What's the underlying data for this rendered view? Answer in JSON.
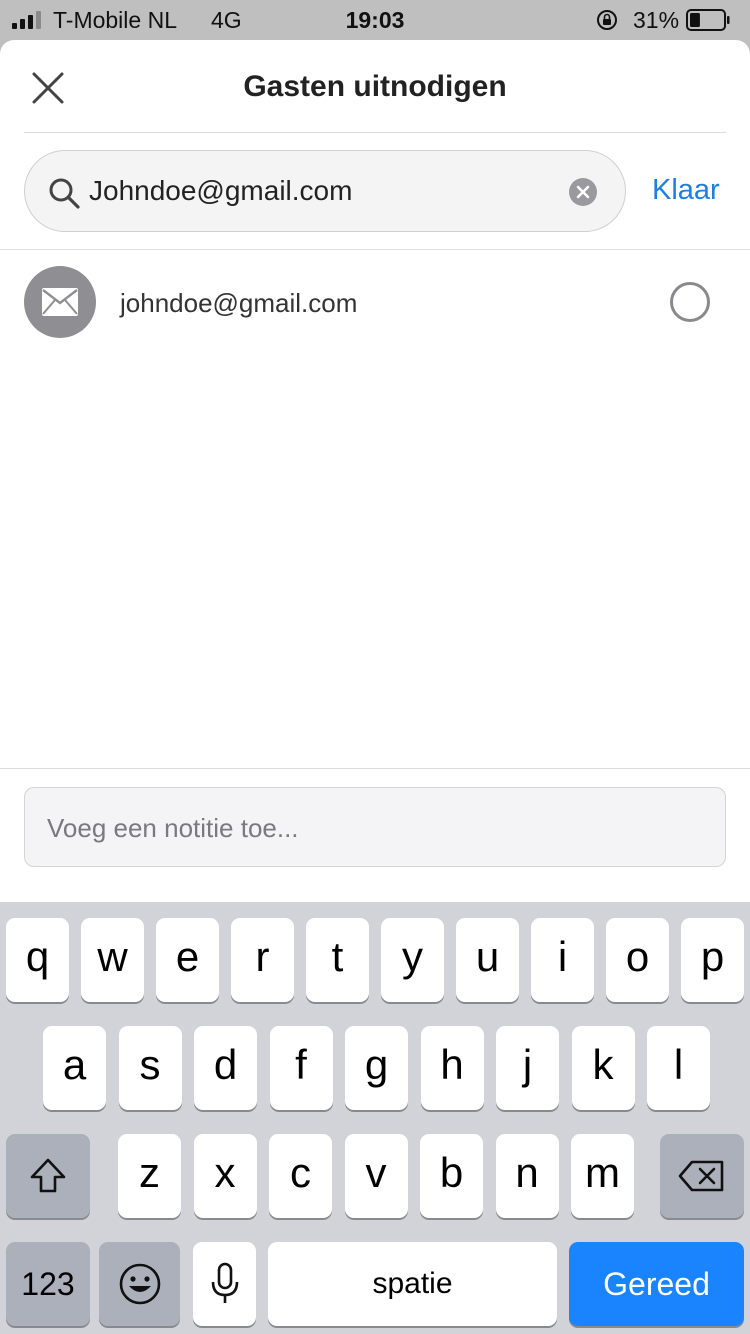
{
  "status_bar": {
    "carrier": "T-Mobile NL",
    "network": "4G",
    "time": "19:03",
    "battery_percent": "31%",
    "battery_level": 0.31,
    "signal_bars": 3
  },
  "header": {
    "title": "Gasten uitnodigen",
    "close_icon": "close-icon"
  },
  "search": {
    "value": "Johndoe@gmail.com",
    "icon": "search-icon",
    "clear_icon": "clear-icon",
    "done_label": "Klaar"
  },
  "results": [
    {
      "email": "johndoe@gmail.com",
      "icon": "mail-icon",
      "selected": false
    }
  ],
  "note": {
    "placeholder": "Voeg een notitie toe..."
  },
  "keyboard": {
    "row1": [
      "q",
      "w",
      "e",
      "r",
      "t",
      "y",
      "u",
      "i",
      "o",
      "p"
    ],
    "row2": [
      "a",
      "s",
      "d",
      "f",
      "g",
      "h",
      "j",
      "k",
      "l"
    ],
    "row3": [
      "z",
      "x",
      "c",
      "v",
      "b",
      "n",
      "m"
    ],
    "numbers_label": "123",
    "space_label": "spatie",
    "return_label": "Gereed"
  },
  "colors": {
    "accent": "#1f7fe0",
    "return_key": "#1a84ff",
    "avatar": "#8e8e93"
  }
}
